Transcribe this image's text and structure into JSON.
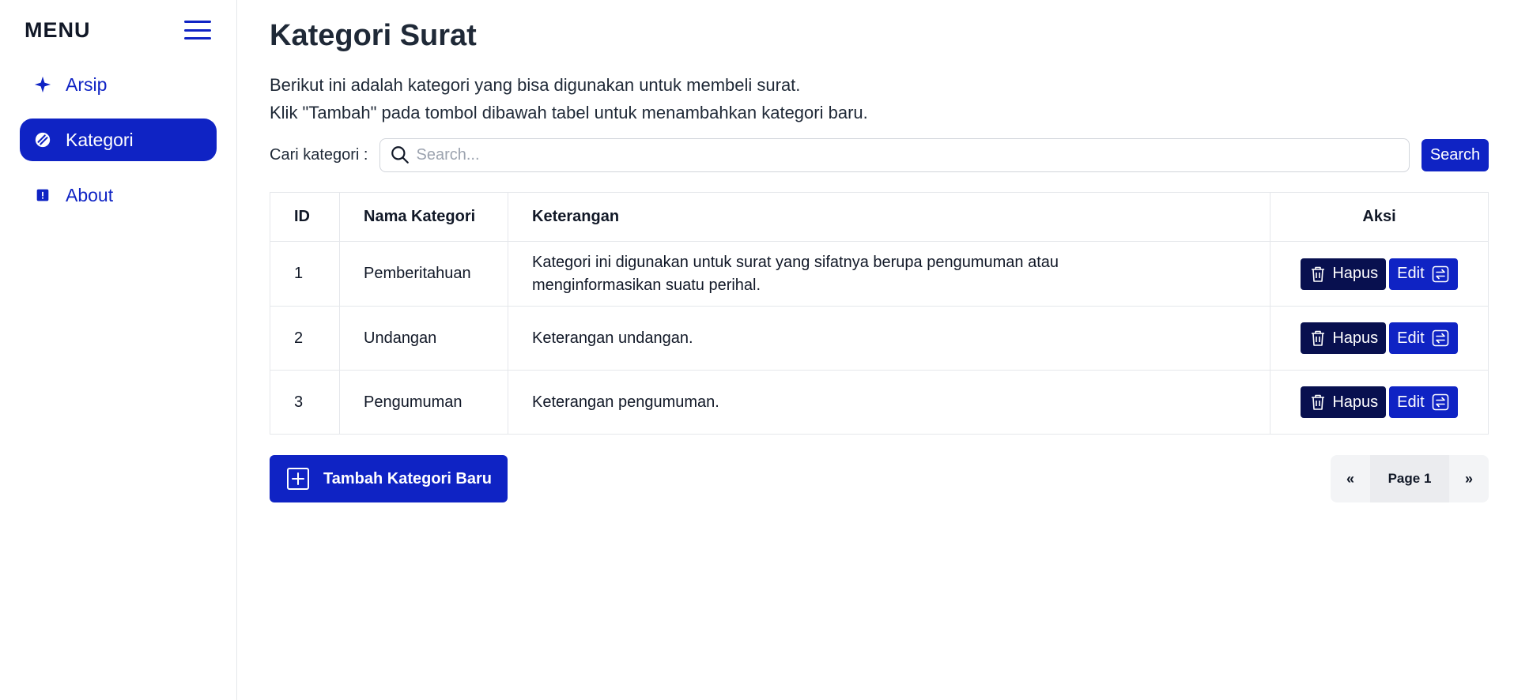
{
  "sidebar": {
    "title": "MENU",
    "items": [
      {
        "label": "Arsip",
        "icon": "sparkle-icon",
        "active": false
      },
      {
        "label": "Kategori",
        "icon": "tag-icon",
        "active": true
      },
      {
        "label": "About",
        "icon": "info-icon",
        "active": false
      }
    ]
  },
  "main": {
    "title": "Kategori Surat",
    "description_line1": "Berikut ini adalah kategori yang bisa digunakan untuk membeli surat.",
    "description_line2": "Klik \"Tambah\" pada tombol dibawah tabel untuk menambahkan kategori baru.",
    "search": {
      "label": "Cari kategori :",
      "placeholder": "Search...",
      "value": "",
      "button_label": "Search"
    },
    "table": {
      "headers": [
        "ID",
        "Nama Kategori",
        "Keterangan",
        "Aksi"
      ],
      "rows": [
        {
          "id": "1",
          "nama": "Pemberitahuan",
          "keterangan": "Kategori ini digunakan untuk surat yang sifatnya berupa pengumuman atau menginformasikan suatu perihal."
        },
        {
          "id": "2",
          "nama": "Undangan",
          "keterangan": "Keterangan undangan."
        },
        {
          "id": "3",
          "nama": "Pengumuman",
          "keterangan": "Keterangan pengumuman."
        }
      ],
      "delete_label": "Hapus",
      "edit_label": "Edit"
    },
    "add_button_label": "Tambah Kategori Baru",
    "pagination": {
      "prev": "«",
      "current": "Page 1",
      "next": "»"
    }
  },
  "colors": {
    "primary": "#0f23c4",
    "danger_dark": "#08104f",
    "text": "#1f2937"
  }
}
